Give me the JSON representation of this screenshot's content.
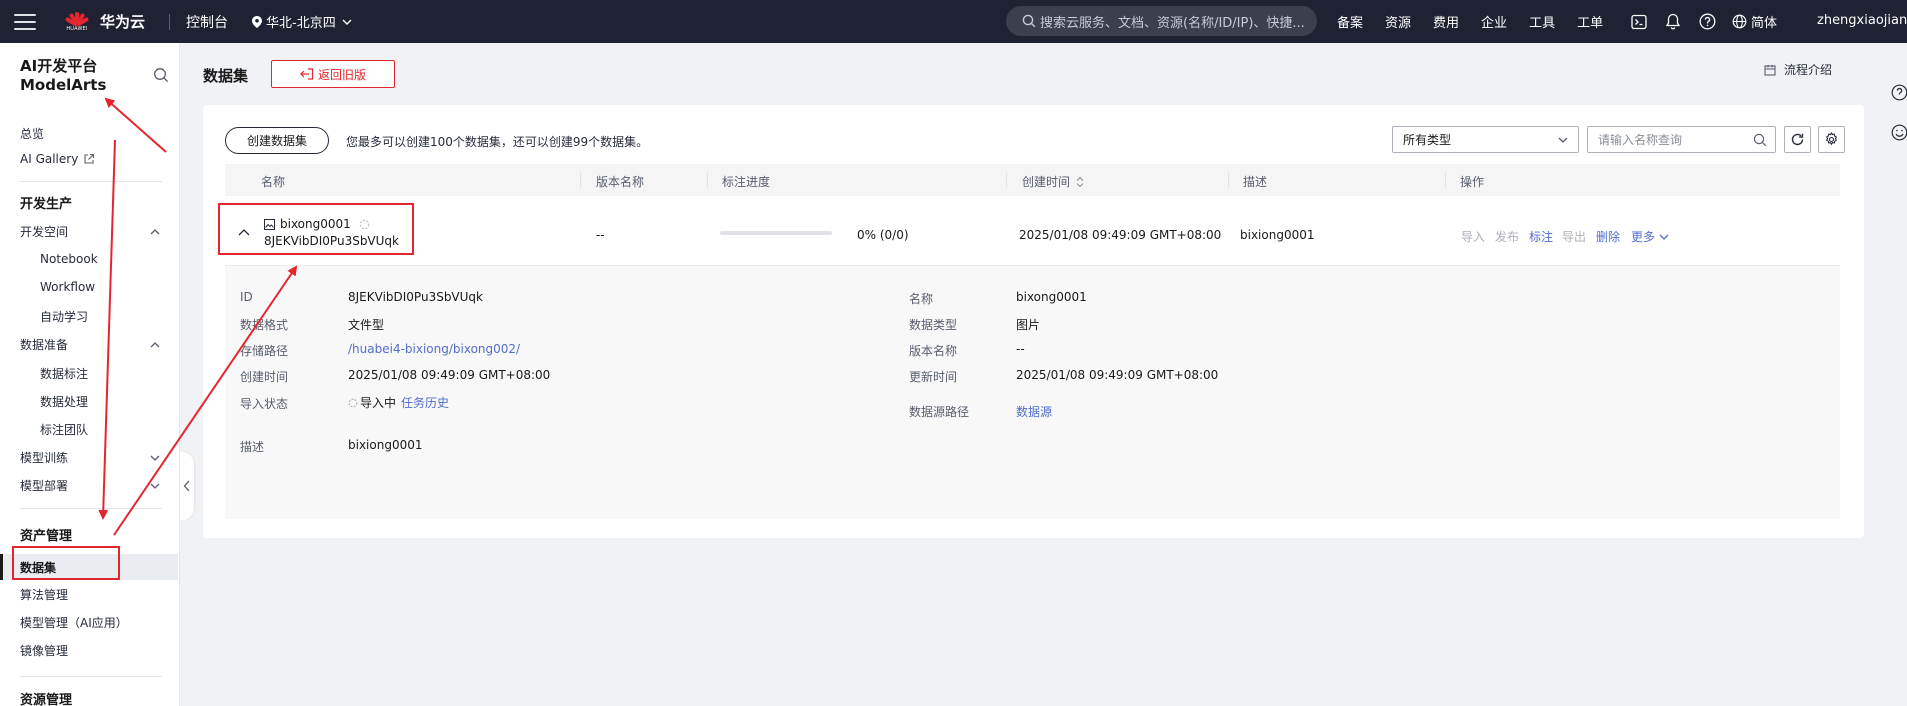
{
  "topbar": {
    "brand_small": "HUAWEI",
    "brand": "华为云",
    "console": "控制台",
    "region": "华北-北京四",
    "search_placeholder": "搜索云服务、文档、资源(名称/ID/IP)、快捷...",
    "nav": [
      "备案",
      "资源",
      "费用",
      "企业",
      "工具",
      "工单"
    ],
    "icons": [
      "terminal-icon",
      "bell-icon",
      "help-icon"
    ],
    "language": "简体",
    "username": "zhengxiaojian"
  },
  "sidebar": {
    "title_line1": "AI开发平台",
    "title_line2": "ModelArts",
    "overview": "总览",
    "ai_gallery": "AI Gallery",
    "dev_production": "开发生产",
    "dev_space": "开发空间",
    "notebook": "Notebook",
    "workflow": "Workflow",
    "auto_learning": "自动学习",
    "data_prep": "数据准备",
    "data_labeling": "数据标注",
    "data_processing": "数据处理",
    "labeling_team": "标注团队",
    "model_training": "模型训练",
    "model_deploy": "模型部署",
    "asset_mgmt": "资产管理",
    "datasets": "数据集",
    "algorithm_mgmt": "算法管理",
    "model_mgmt": "模型管理（AI应用）",
    "image_mgmt": "镜像管理",
    "resource_mgmt": "资源管理"
  },
  "main": {
    "title": "数据集",
    "back_old_label": "返回旧版",
    "flow_intro_label": "流程介绍",
    "create_label": "创建数据集",
    "quota_text": "您最多可以创建100个数据集，还可以创建99个数据集。",
    "type_select_value": "所有类型",
    "search_placeholder": "请输入名称查询",
    "columns": {
      "name": "名称",
      "version": "版本名称",
      "progress": "标注进度",
      "created": "创建时间",
      "description": "描述",
      "actions": "操作"
    },
    "row": {
      "name": "bixong0001",
      "id": "8JEKVibDI0Pu3SbVUqk",
      "version": "--",
      "progress_text": "0% (0/0)",
      "progress_value": 0,
      "created": "2025/01/08 09:49:09 GMT+08:00",
      "description": "bixiong0001",
      "actions": {
        "import": "导入",
        "publish": "发布",
        "label": "标注",
        "export": "导出",
        "delete": "删除",
        "more": "更多"
      }
    },
    "detail": {
      "id_label": "ID",
      "id_value": "8JEKVibDI0Pu3SbVUqk",
      "format_label": "数据格式",
      "format_value": "文件型",
      "path_label": "存储路径",
      "path_value": "/huabei4-bixiong/bixong002/",
      "created_label": "创建时间",
      "created_value": "2025/01/08 09:49:09 GMT+08:00",
      "import_status_label": "导入状态",
      "import_status_value": "导入中",
      "task_history": "任务历史",
      "desc_label": "描述",
      "desc_value": "bixiong0001",
      "name_label": "名称",
      "name_value": "bixong0001",
      "data_type_label": "数据类型",
      "data_type_value": "图片",
      "version_label": "版本名称",
      "version_value": "--",
      "updated_label": "更新时间",
      "updated_value": "2025/01/08 09:49:09 GMT+08:00",
      "source_path_label": "数据源路径",
      "source_path_value": "数据源"
    }
  },
  "colors": {
    "topbar_bg": "#1e2233",
    "accent_red": "#e3262e",
    "link_blue": "#526ecc",
    "sidebar_active": "#e9ecf1"
  }
}
